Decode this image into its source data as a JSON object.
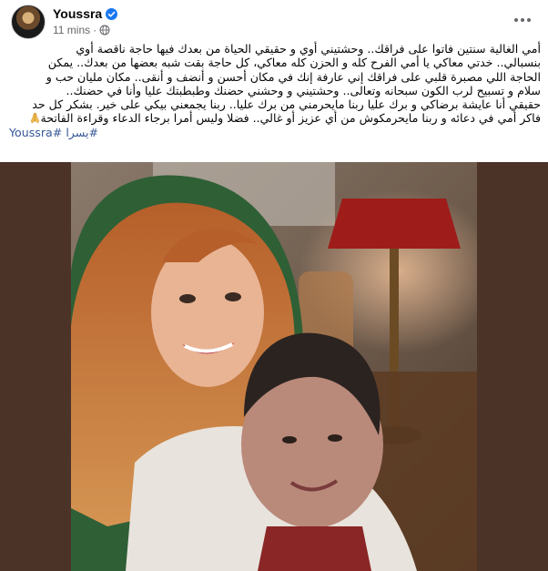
{
  "post": {
    "author": "Youssra",
    "timestamp": "11 mins",
    "separator": "·",
    "text_lines": [
      "أمي الغالية سنتين فاتوا على فراقك.. وحشتيني أوي و حقيقي الحياة من بعدك فيها حاجة ناقصة أوي",
      "بنسبالي.. خدتي معاكي يا أمي الفرح كله و الحزن كله معاكي، كل حاجة بقت شبه بعضها من بعدك.. يمكن",
      "الحاجة اللي مصبرة قلبي على فراقك إني عارفة إنك في مكان أحسن و أنضف و أنقى.. مكان مليان حب و",
      "سلام و تسبيح لرب الكون سبحانه وتعالى.. وحشتيني و وحشني حضنك وطبطبتك عليا وأنا في حضنك..",
      "حقيقي أنا عايشة برضاكي و برك عليا ربنا مايحرمني من برك عليا.. ربنا يجمعني بيكي على خير. بشكر كل حد",
      "فاكر أمي في دعائه و ربنا مايحرمكوش من أي عزيز أو غالي.. فضلا وليس أمرا برجاء الدعاء وقراءة الفاتحة"
    ],
    "hashtags": [
      "#يسرا",
      "#Youssra"
    ]
  },
  "colors": {
    "text": "#050505",
    "secondary_text": "#65676b",
    "link": "#385898",
    "verified": "#1877f2",
    "photo_background": "#4b3328"
  },
  "icons": {
    "verified": "verified-badge-icon",
    "audience": "globe-icon",
    "menu": "more-options-icon",
    "emoji": "praying-hands-emoji"
  }
}
